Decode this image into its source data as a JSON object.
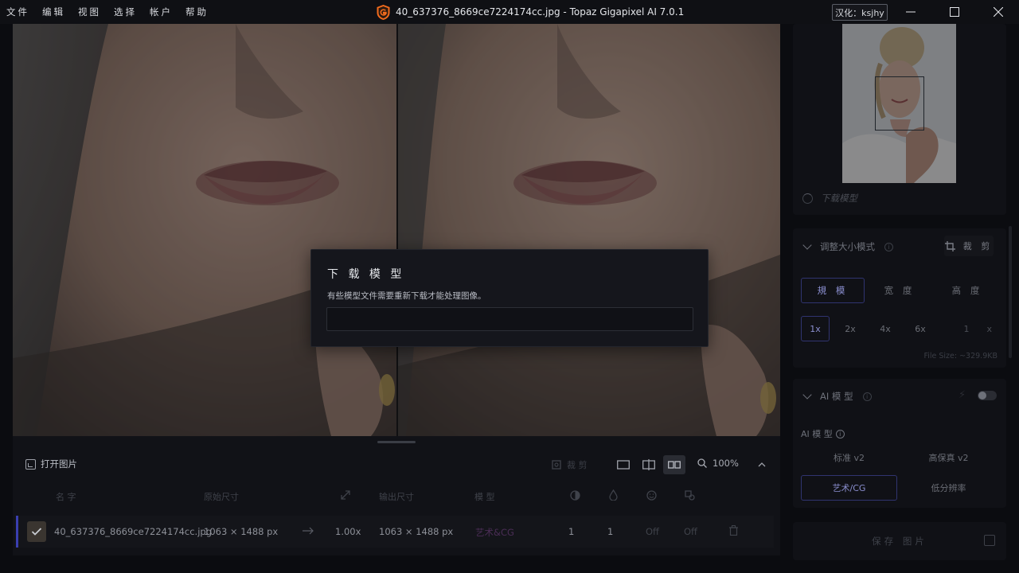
{
  "menu": [
    "文件",
    "编辑",
    "视图",
    "选择",
    "帐户",
    "帮助"
  ],
  "window": {
    "title": "40_637376_8669ce7224174cc.jpg - Topaz Gigapixel AI 7.0.1",
    "locale_badge": "汉化：ksjhy",
    "controls": [
      "minimize-icon",
      "maximize-icon",
      "close-icon"
    ]
  },
  "colors": {
    "accent": "#3a3fb0",
    "brand": "#f26b1d"
  },
  "toolbar": {
    "open_image": "打开图片",
    "crop": "裁 剪",
    "view_modes": [
      "single-view-icon",
      "split-view-icon",
      "side-by-side-icon"
    ],
    "active_view": "side-by-side",
    "zoom": "100%"
  },
  "table": {
    "headers": {
      "name": "名 字",
      "original_size": "原始尺寸",
      "output_size": "输出尺寸",
      "model": "模 型"
    },
    "row": {
      "name": "40_637376_8669ce7224174cc.jpg",
      "original_size": "1063 × 1488 px",
      "scale": "1.00x",
      "output_size": "1063 × 1488 px",
      "model": "艺术&CG",
      "denoise": "1",
      "sharpen": "1",
      "face": "Off",
      "color": "Off"
    }
  },
  "right_panel": {
    "download_status": "下载模型",
    "resize": {
      "title": "调整大小模式",
      "crop": "裁 剪",
      "modes": [
        "規 模",
        "宽 度",
        "高 度"
      ],
      "active_mode": 0,
      "multipliers": [
        "1x",
        "2x",
        "4x",
        "6x"
      ],
      "active_multiplier": 0,
      "custom_value": "1",
      "custom_unit": "x",
      "file_size": "File Size: ~329.9KB"
    },
    "ai": {
      "title": "AI 模 型",
      "enabled": false,
      "subtitle": "AI 模 型",
      "models": [
        "标准 v2",
        "高保真 v2",
        "艺术/CG",
        "低分辨率"
      ],
      "active_model": 2
    },
    "save": "保存 图片"
  },
  "modal": {
    "title": "下 载 模 型",
    "message": "有些模型文件需要重新下载才能处理图像。",
    "progress": 0
  }
}
